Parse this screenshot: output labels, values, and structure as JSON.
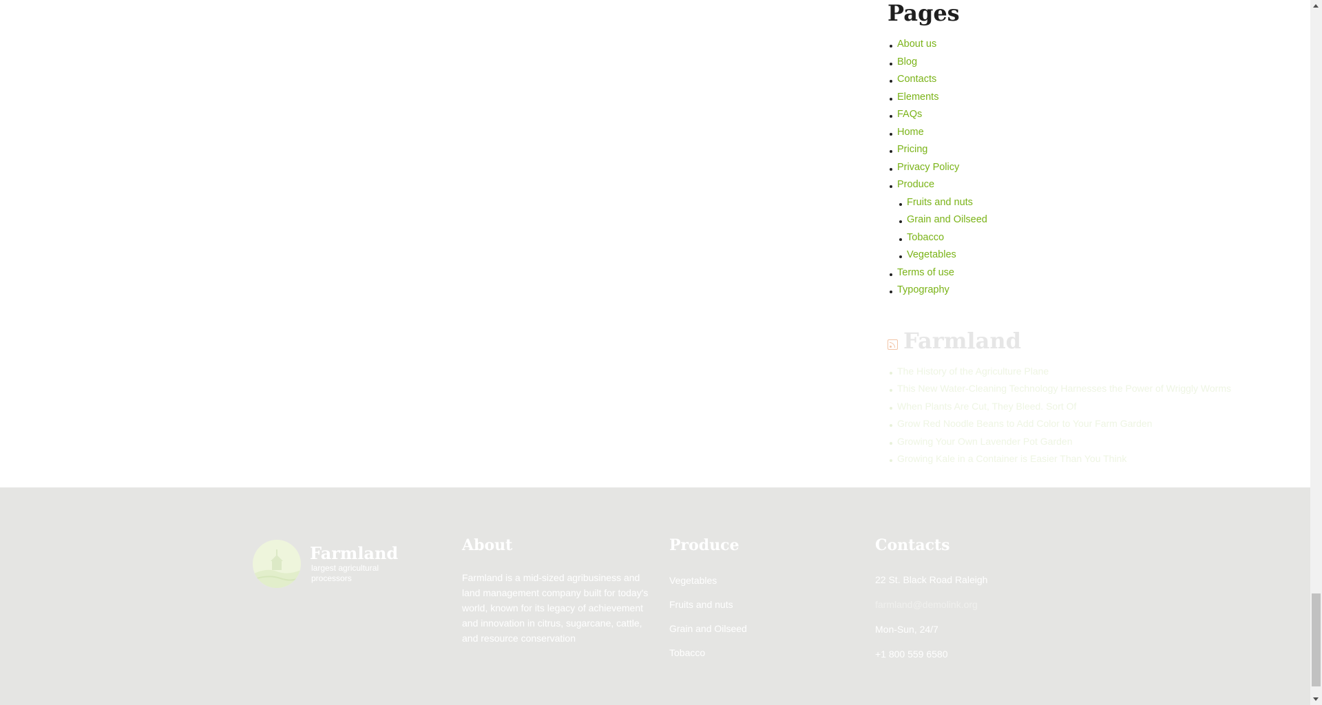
{
  "sidebar": {
    "pages_title": "Pages",
    "pages": [
      {
        "label": "About us"
      },
      {
        "label": "Blog"
      },
      {
        "label": "Contacts"
      },
      {
        "label": "Elements"
      },
      {
        "label": "FAQs"
      },
      {
        "label": "Home"
      },
      {
        "label": "Pricing"
      },
      {
        "label": "Privacy Policy"
      },
      {
        "label": "Produce",
        "children": [
          {
            "label": "Fruits and nuts"
          },
          {
            "label": "Grain and Oilseed"
          },
          {
            "label": "Tobacco"
          },
          {
            "label": "Vegetables"
          }
        ]
      },
      {
        "label": "Terms of use"
      },
      {
        "label": "Typography"
      }
    ],
    "rss_title": "Farmland",
    "rss_items": [
      "The History of the Agriculture Plane",
      "This New Water-Cleaning Technology Harnesses the Power of Wriggly Worms",
      "When Plants Are Cut, They Bleed. Sort Of",
      "Grow Red Noodle Beans to Add Color to Your Farm Garden",
      "Growing Your Own Lavender Pot Garden",
      "Growing Kale in a Container is Easier Than You Think"
    ]
  },
  "footer": {
    "brand": {
      "name": "Farmland",
      "tagline": "largest agricultural processors"
    },
    "about": {
      "title": "About",
      "text": "Farmland is a mid-sized agribusiness and land management company built for today's world, known for its legacy of achievement and innovation in citrus, sugarcane, cattle, and resource conservation"
    },
    "produce": {
      "title": "Produce",
      "items": [
        "Vegetables",
        "Fruits and nuts",
        "Grain and Oilseed",
        "Tobacco"
      ]
    },
    "contacts": {
      "title": "Contacts",
      "address": "22 St. Black Road Raleigh",
      "email": "farmland@demolink.org",
      "hours": "Mon-Sun, 24/7",
      "phone": "+1 800 559 6580"
    }
  },
  "colors": {
    "link": "#7ab317",
    "footer_bg": "#e5e5e3",
    "heading": "#1f1f1f"
  },
  "icons": {
    "rss": "rss-icon",
    "logo": "farmland-logo-icon"
  }
}
